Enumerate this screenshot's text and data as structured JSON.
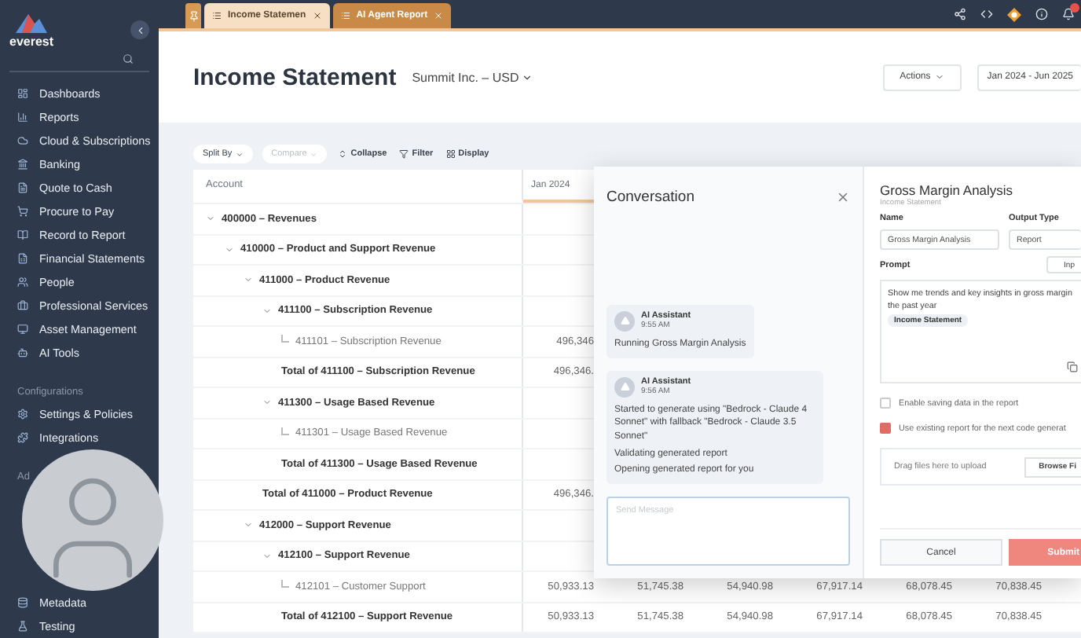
{
  "sidebar": {
    "logo": "everest",
    "sections": [
      {
        "items": [
          {
            "label": "Dashboards"
          },
          {
            "label": "Reports"
          },
          {
            "label": "Cloud & Subscriptions"
          },
          {
            "label": "Banking"
          },
          {
            "label": "Quote to Cash"
          },
          {
            "label": "Procure to Pay"
          },
          {
            "label": "Record to Report"
          },
          {
            "label": "Financial Statements"
          },
          {
            "label": "People"
          },
          {
            "label": "Professional Services"
          },
          {
            "label": "Asset Management"
          },
          {
            "label": "AI Tools"
          }
        ]
      },
      {
        "title": "Configurations",
        "items": [
          {
            "label": "Settings & Policies"
          },
          {
            "label": "Integrations"
          }
        ]
      },
      {
        "title": "Ad",
        "items": [
          {
            "label": "Metadata"
          },
          {
            "label": "Testing"
          }
        ]
      }
    ]
  },
  "tabs": [
    {
      "label": "Income Statemen",
      "selected": true
    },
    {
      "label": "AI Agent Report",
      "selected": false
    }
  ],
  "header": {
    "title": "Income Statement",
    "entity": "Summit Inc. – USD",
    "actions": "Actions",
    "date_range": "Jan 2024 - Jun 2025"
  },
  "toolbar": [
    {
      "label": "Split By",
      "kind": "dropdown",
      "disabled": false
    },
    {
      "label": "Compare",
      "kind": "dropdown",
      "disabled": true
    },
    {
      "label": "Collapse",
      "kind": "collapse"
    },
    {
      "label": "Filter",
      "kind": "filter"
    },
    {
      "label": "Display",
      "kind": "display"
    }
  ],
  "table": {
    "columns": [
      {
        "label": "Account",
        "selected": false
      },
      {
        "label": "Jan 2024",
        "selected": true
      }
    ],
    "rows": [
      {
        "kind": "group",
        "label": "400000 – Revenues",
        "expanded": true,
        "children": [
          {
            "kind": "group",
            "label": "410000 – Product and Support Revenue",
            "expanded": true,
            "children": [
              {
                "kind": "group",
                "label": "411000 – Product Revenue",
                "expanded": true,
                "children": [
                  {
                    "kind": "group",
                    "label": "411100 – Subscription Revenue",
                    "expanded": true,
                    "children": [
                      {
                        "kind": "leaf",
                        "label": "411101 – Subscription Revenue",
                        "values": [
                          "496,346"
                        ]
                      },
                      {
                        "kind": "total",
                        "label": "Total of 411100 – Subscription Revenue",
                        "values": [
                          "496,346."
                        ]
                      }
                    ]
                  },
                  {
                    "kind": "group",
                    "label": "411300 – Usage Based Revenue",
                    "expanded": true,
                    "children": [
                      {
                        "kind": "leaf",
                        "label": "411301 – Usage Based Revenue"
                      },
                      {
                        "kind": "total",
                        "label": "Total of 411300 – Usage Based Revenue"
                      }
                    ]
                  },
                  {
                    "kind": "total",
                    "label": "Total of 411000 – Product Revenue",
                    "values": [
                      "496,346."
                    ]
                  }
                ]
              },
              {
                "kind": "group",
                "label": "412000 – Support Revenue",
                "expanded": true,
                "children": [
                  {
                    "kind": "group",
                    "label": "412100 – Support Revenue",
                    "expanded": true,
                    "children": [
                      {
                        "kind": "leaf",
                        "label": "412101 – Customer Support",
                        "values": [
                          "50,933.13",
                          "51,745.38",
                          "54,940.98",
                          "67,917.14",
                          "68,078.45",
                          "70,838.45"
                        ]
                      },
                      {
                        "kind": "total",
                        "label": "Total of 412100 – Support Revenue",
                        "values": [
                          "50,933.13",
                          "51,745.38",
                          "54,940.98",
                          "67,917.14",
                          "68,078.45",
                          "70,838.45"
                        ]
                      }
                    ]
                  }
                ]
              }
            ]
          }
        ]
      }
    ]
  },
  "conversation": {
    "title": "Conversation",
    "messages": [
      {
        "author": "AI Assistant",
        "time": "9:55 AM",
        "lines": [
          "Running Gross Margin Analysis"
        ]
      },
      {
        "author": "AI Assistant",
        "time": "9:56 AM",
        "lines": [
          "Started to generate using \"Bedrock - Claude 4 Sonnet\" with fallback \"Bedrock - Claude 3.5 Sonnet\"",
          "Validating generated report",
          "Opening generated report for you"
        ]
      }
    ],
    "input_placeholder": "Send Message"
  },
  "report_form": {
    "title": "Gross Margin Analysis",
    "subtitle": "Income Statement",
    "name_label": "Name",
    "name_value": "Gross Margin Analysis",
    "output_label": "Output Type",
    "output_value": "Report",
    "prompt_label": "Prompt",
    "prompt_button": "Inp",
    "prompt_lines": [
      "Show me trends and key insights in gross margin",
      "the past year"
    ],
    "prompt_chip": "Income Statement",
    "checkboxes": [
      {
        "label": "Enable saving data in the report",
        "checked": false
      },
      {
        "label": "Use existing report for the next code generat",
        "checked": true
      }
    ],
    "upload_hint": "Drag files here to upload",
    "browse": "Browse Fi",
    "cancel": "Cancel",
    "submit": "Submit"
  }
}
